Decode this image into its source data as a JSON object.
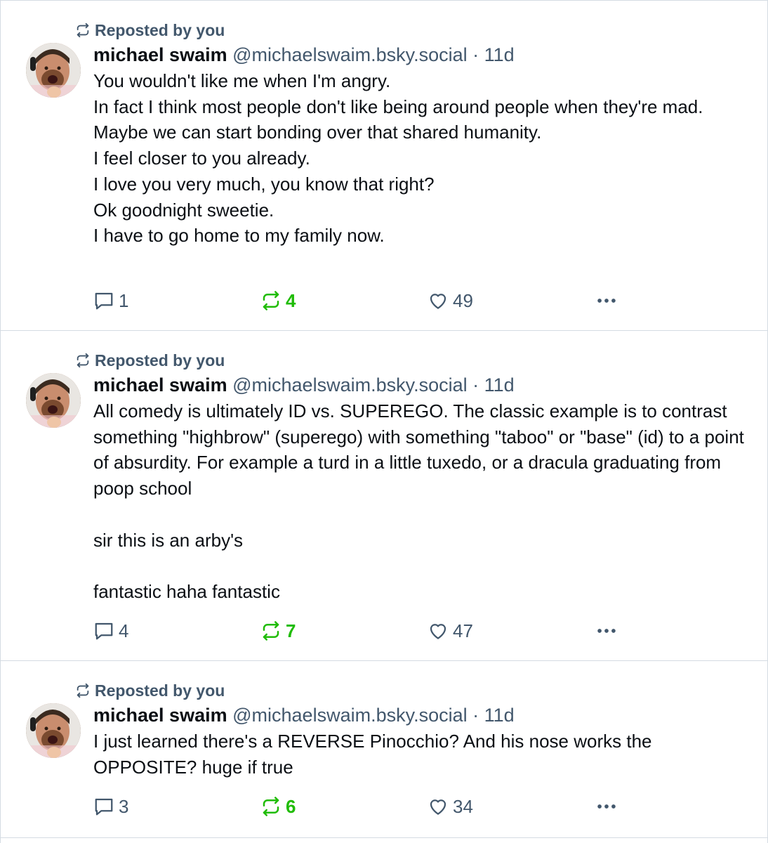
{
  "colors": {
    "muted": "#42576c",
    "repost_active": "#20bc07",
    "border": "#d4dbe2",
    "text": "#0b0f14"
  },
  "icons": {
    "repost_context": "repost-icon",
    "reply": "comment-icon",
    "repost": "repost-icon",
    "like": "heart-icon",
    "more": "more-options-icon"
  },
  "posts": [
    {
      "repost_label": "Reposted by you",
      "author_name": "michael swaim",
      "author_handle": "@michaelswaim.bsky.social",
      "separator": "·",
      "time": "11d",
      "text": "You wouldn't like me when I'm angry.\nIn fact I think most people don't like being around people when they're mad.\nMaybe we can start bonding over that shared humanity.\nI feel closer to you already.\nI love you very much, you know that right?\nOk goodnight sweetie.\nI have to go home to my family now.",
      "reply_count": "1",
      "repost_count": "4",
      "like_count": "49"
    },
    {
      "repost_label": "Reposted by you",
      "author_name": "michael swaim",
      "author_handle": "@michaelswaim.bsky.social",
      "separator": "·",
      "time": "11d",
      "text": "All comedy is ultimately ID vs. SUPEREGO. The classic example is to contrast something \"highbrow\" (superego) with something \"taboo\" or \"base\" (id) to a point of absurdity. For example a turd in a little tuxedo, or a dracula graduating from poop school\n\nsir this is an arby's\n\nfantastic haha fantastic",
      "reply_count": "4",
      "repost_count": "7",
      "like_count": "47"
    },
    {
      "repost_label": "Reposted by you",
      "author_name": "michael swaim",
      "author_handle": "@michaelswaim.bsky.social",
      "separator": "·",
      "time": "11d",
      "text": "I just learned there's a REVERSE Pinocchio? And his nose works the OPPOSITE? huge if true",
      "reply_count": "3",
      "repost_count": "6",
      "like_count": "34"
    }
  ]
}
